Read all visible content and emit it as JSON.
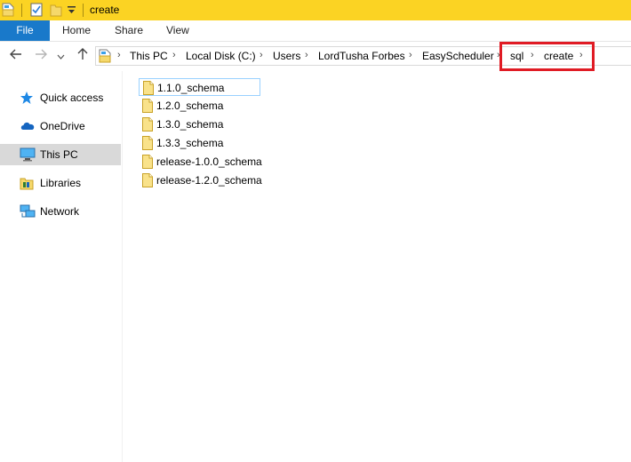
{
  "window": {
    "title": "create"
  },
  "ribbon": {
    "file_label": "File",
    "tabs": [
      "Home",
      "Share",
      "View"
    ]
  },
  "address": {
    "crumbs": [
      "This PC",
      "Local Disk (C:)",
      "Users",
      "LordTusha Forbes",
      "EasyScheduler",
      "sql",
      "create"
    ]
  },
  "nav_pane": {
    "items": [
      {
        "label": "Quick access",
        "icon": "star-icon"
      },
      {
        "label": "OneDrive",
        "icon": "cloud-icon"
      },
      {
        "label": "This PC",
        "icon": "monitor-icon",
        "selected": true
      },
      {
        "label": "Libraries",
        "icon": "library-icon"
      },
      {
        "label": "Network",
        "icon": "network-icon"
      }
    ]
  },
  "files": [
    "1.1.0_schema",
    "1.2.0_schema",
    "1.3.0_schema",
    "1.3.3_schema",
    "release-1.0.0_schema",
    "release-1.2.0_schema"
  ],
  "colors": {
    "titlebar": "#fbd323",
    "file_tab": "#1979ca",
    "highlight_box": "#e01b24",
    "selected_nav": "#d9d9d9"
  }
}
